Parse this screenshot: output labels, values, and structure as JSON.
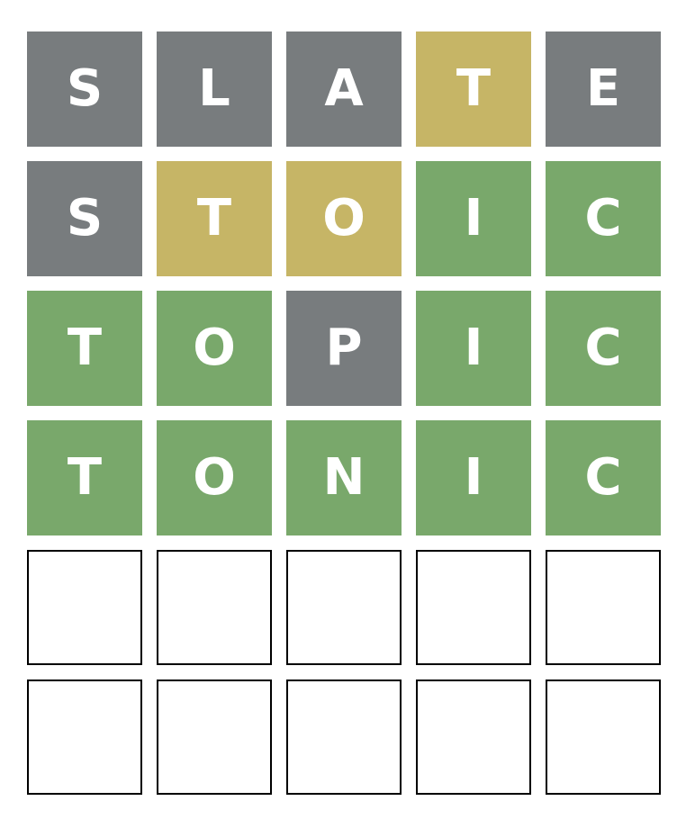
{
  "colors": {
    "absent": "#787c7e",
    "present": "#c6b566",
    "correct": "#79a86b",
    "empty_border": "#000000"
  },
  "board": {
    "rows": [
      {
        "tiles": [
          {
            "letter": "S",
            "state": "absent"
          },
          {
            "letter": "L",
            "state": "absent"
          },
          {
            "letter": "A",
            "state": "absent"
          },
          {
            "letter": "T",
            "state": "present"
          },
          {
            "letter": "E",
            "state": "absent"
          }
        ]
      },
      {
        "tiles": [
          {
            "letter": "S",
            "state": "absent"
          },
          {
            "letter": "T",
            "state": "present"
          },
          {
            "letter": "O",
            "state": "present"
          },
          {
            "letter": "I",
            "state": "correct"
          },
          {
            "letter": "C",
            "state": "correct"
          }
        ]
      },
      {
        "tiles": [
          {
            "letter": "T",
            "state": "correct"
          },
          {
            "letter": "O",
            "state": "correct"
          },
          {
            "letter": "P",
            "state": "absent"
          },
          {
            "letter": "I",
            "state": "correct"
          },
          {
            "letter": "C",
            "state": "correct"
          }
        ]
      },
      {
        "tiles": [
          {
            "letter": "T",
            "state": "correct"
          },
          {
            "letter": "O",
            "state": "correct"
          },
          {
            "letter": "N",
            "state": "correct"
          },
          {
            "letter": "I",
            "state": "correct"
          },
          {
            "letter": "C",
            "state": "correct"
          }
        ]
      },
      {
        "tiles": [
          {
            "letter": "",
            "state": "empty"
          },
          {
            "letter": "",
            "state": "empty"
          },
          {
            "letter": "",
            "state": "empty"
          },
          {
            "letter": "",
            "state": "empty"
          },
          {
            "letter": "",
            "state": "empty"
          }
        ]
      },
      {
        "tiles": [
          {
            "letter": "",
            "state": "empty"
          },
          {
            "letter": "",
            "state": "empty"
          },
          {
            "letter": "",
            "state": "empty"
          },
          {
            "letter": "",
            "state": "empty"
          },
          {
            "letter": "",
            "state": "empty"
          }
        ]
      }
    ]
  }
}
